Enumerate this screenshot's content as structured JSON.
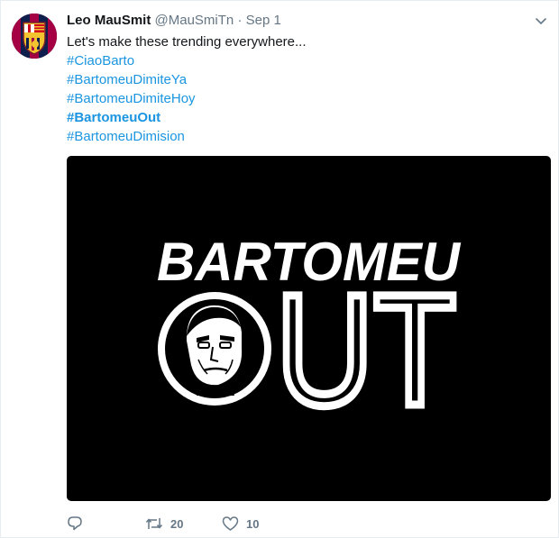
{
  "tweet": {
    "display_name": "Leo MauSmit",
    "handle": "@MauSmiTn",
    "separator": "·",
    "date": "Sep 1",
    "text": "Let's make these trending everywhere...",
    "hashtags": [
      {
        "text": "#CiaoBarto",
        "bold": false
      },
      {
        "text": "#BartomeuDimiteYa",
        "bold": false
      },
      {
        "text": "#BartomeuDimiteHoy",
        "bold": false
      },
      {
        "text": "#BartomeuOut",
        "bold": true
      },
      {
        "text": "#BartomeuDimision",
        "bold": false
      }
    ],
    "media": {
      "line1": "BARTOMEU",
      "line2": "UT"
    },
    "actions": {
      "reply_count": "",
      "retweet_count": "20",
      "like_count": "10"
    }
  },
  "colors": {
    "link": "#1b95e0",
    "muted": "#657786",
    "media_bg": "#000000"
  },
  "icons": [
    "fc-barcelona-crest-avatar",
    "chevron-down-icon",
    "reply-icon",
    "retweet-icon",
    "heart-icon"
  ]
}
